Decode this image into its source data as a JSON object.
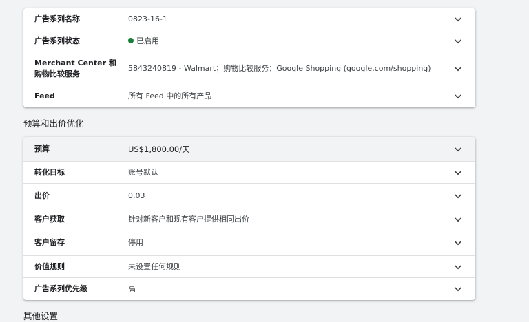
{
  "campaign_card": {
    "rows": [
      {
        "label": "广告系列名称",
        "value": "0823-16-1"
      },
      {
        "label": "广告系列状态",
        "value": "已启用"
      },
      {
        "label": "Merchant Center 和购物比较服务",
        "value": "5843240819 - Walmart；购物比较服务：Google Shopping (google.com/shopping)"
      },
      {
        "label": "Feed",
        "value": "所有 Feed 中的所有产品"
      }
    ]
  },
  "budget_section": {
    "title": "预算和出价优化",
    "rows": [
      {
        "label": "预算",
        "value": "US$1,800.00/天"
      },
      {
        "label": "转化目标",
        "value": "账号默认"
      },
      {
        "label": "出价",
        "value": "0.03"
      },
      {
        "label": "客户获取",
        "value": "针对新客户和现有客户提供相同出价"
      },
      {
        "label": "客户留存",
        "value": "停用"
      },
      {
        "label": "价值规则",
        "value": "未设置任何规则"
      },
      {
        "label": "广告系列优先级",
        "value": "高"
      }
    ]
  },
  "other_section": {
    "title": "其他设置"
  },
  "colors": {
    "status_enabled": "#188038",
    "background": "#f1f3f4",
    "card": "#ffffff"
  },
  "icons": {
    "row_expand": "chevron-down-icon"
  }
}
